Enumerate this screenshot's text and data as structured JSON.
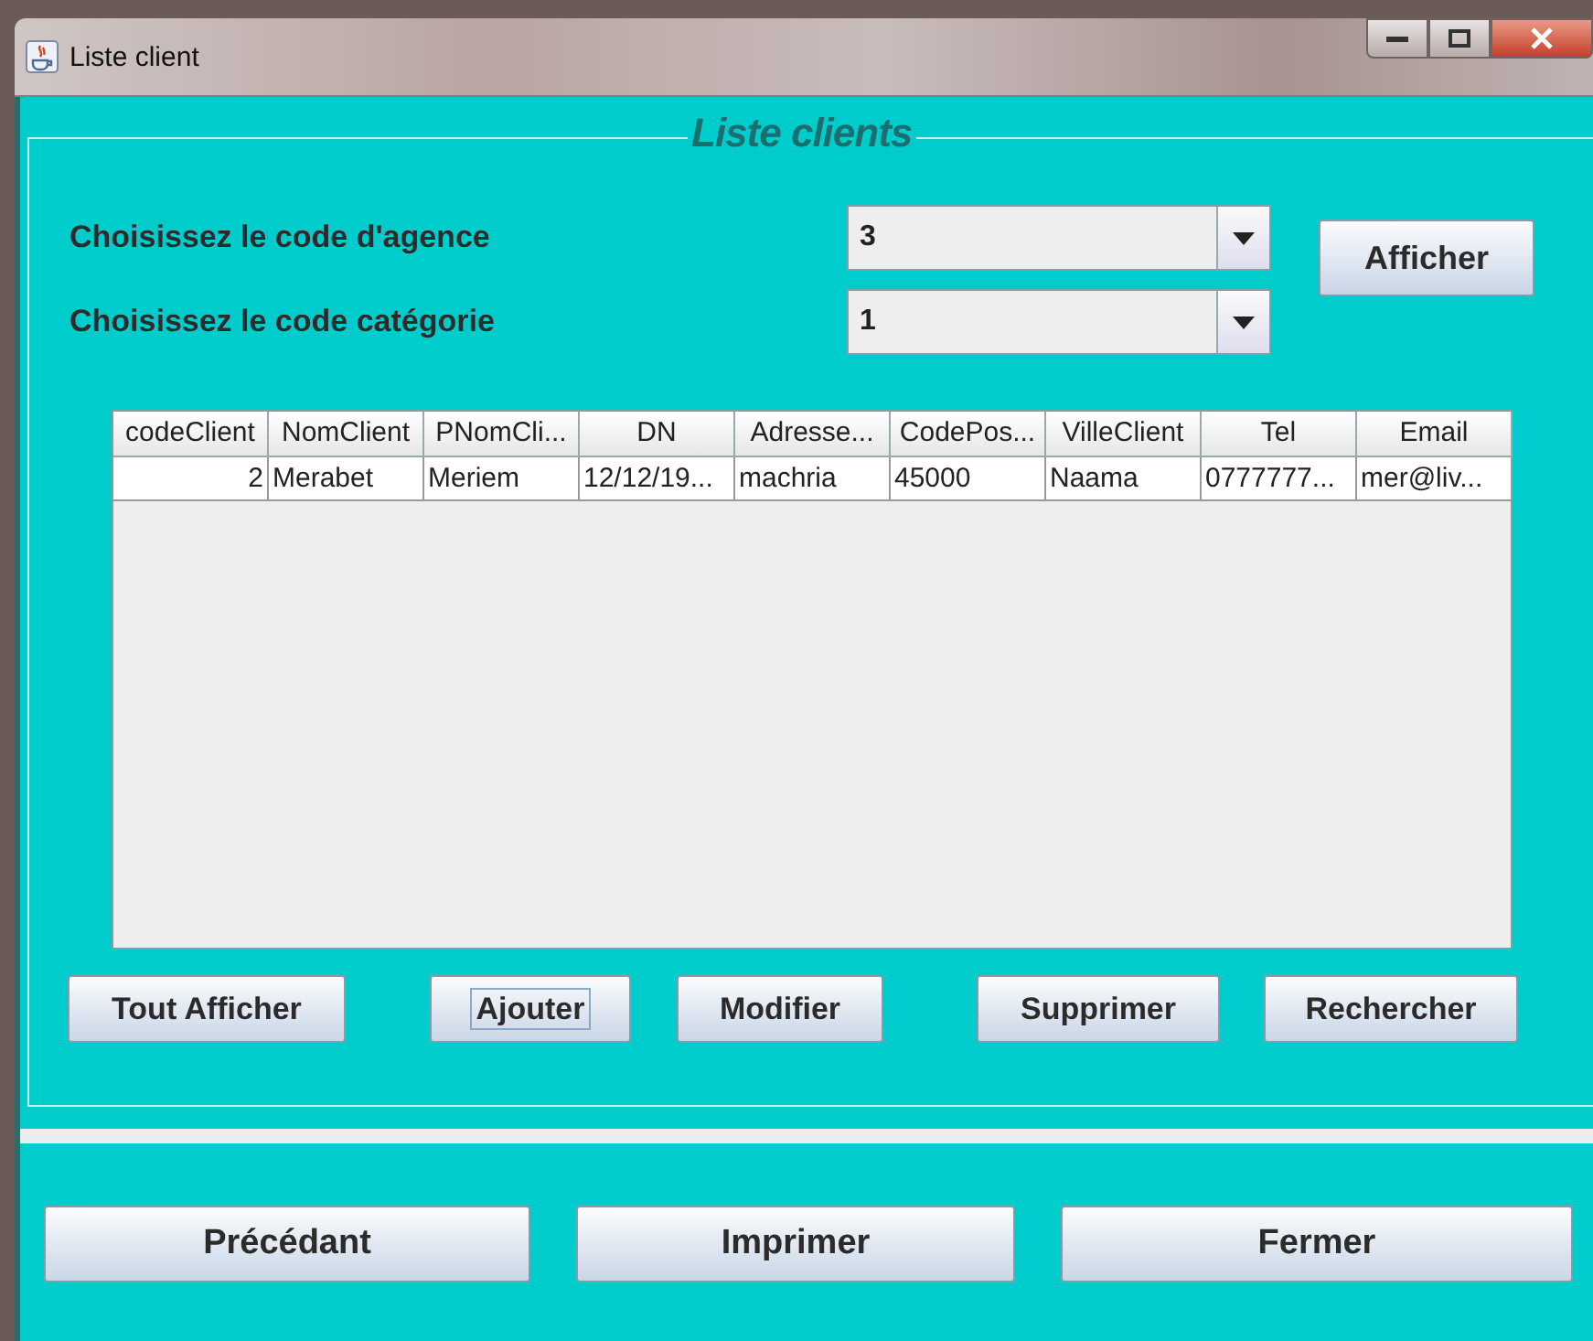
{
  "window": {
    "title": "Liste client"
  },
  "panel": {
    "title": "Liste clients"
  },
  "filters": [
    {
      "label": "Choisissez le code d'agence",
      "value": "3"
    },
    {
      "label": "Choisissez le code catégorie",
      "value": "1"
    }
  ],
  "show_button": "Afficher",
  "table": {
    "columns": [
      {
        "label": "codeClient",
        "kind": "number"
      },
      {
        "label": "NomClient",
        "kind": "text"
      },
      {
        "label": "PNomCli...",
        "kind": "text"
      },
      {
        "label": "DN",
        "kind": "text"
      },
      {
        "label": "Adresse...",
        "kind": "text"
      },
      {
        "label": "CodePos...",
        "kind": "text"
      },
      {
        "label": "VilleClient",
        "kind": "text"
      },
      {
        "label": "Tel",
        "kind": "text"
      },
      {
        "label": "Email",
        "kind": "text"
      }
    ],
    "rows": [
      [
        "2",
        "Merabet",
        "Meriem",
        "12/12/19...",
        "machria",
        "45000",
        "Naama",
        "0777777...",
        "mer@liv..."
      ]
    ]
  },
  "actions": [
    {
      "label": "Tout Afficher",
      "focused": false
    },
    {
      "label": "Ajouter",
      "focused": true
    },
    {
      "label": "Modifier",
      "focused": false
    },
    {
      "label": "Supprimer",
      "focused": false
    },
    {
      "label": "Rechercher",
      "focused": false
    }
  ],
  "footer_buttons": [
    "Précédant",
    "Imprimer",
    "Fermer"
  ]
}
